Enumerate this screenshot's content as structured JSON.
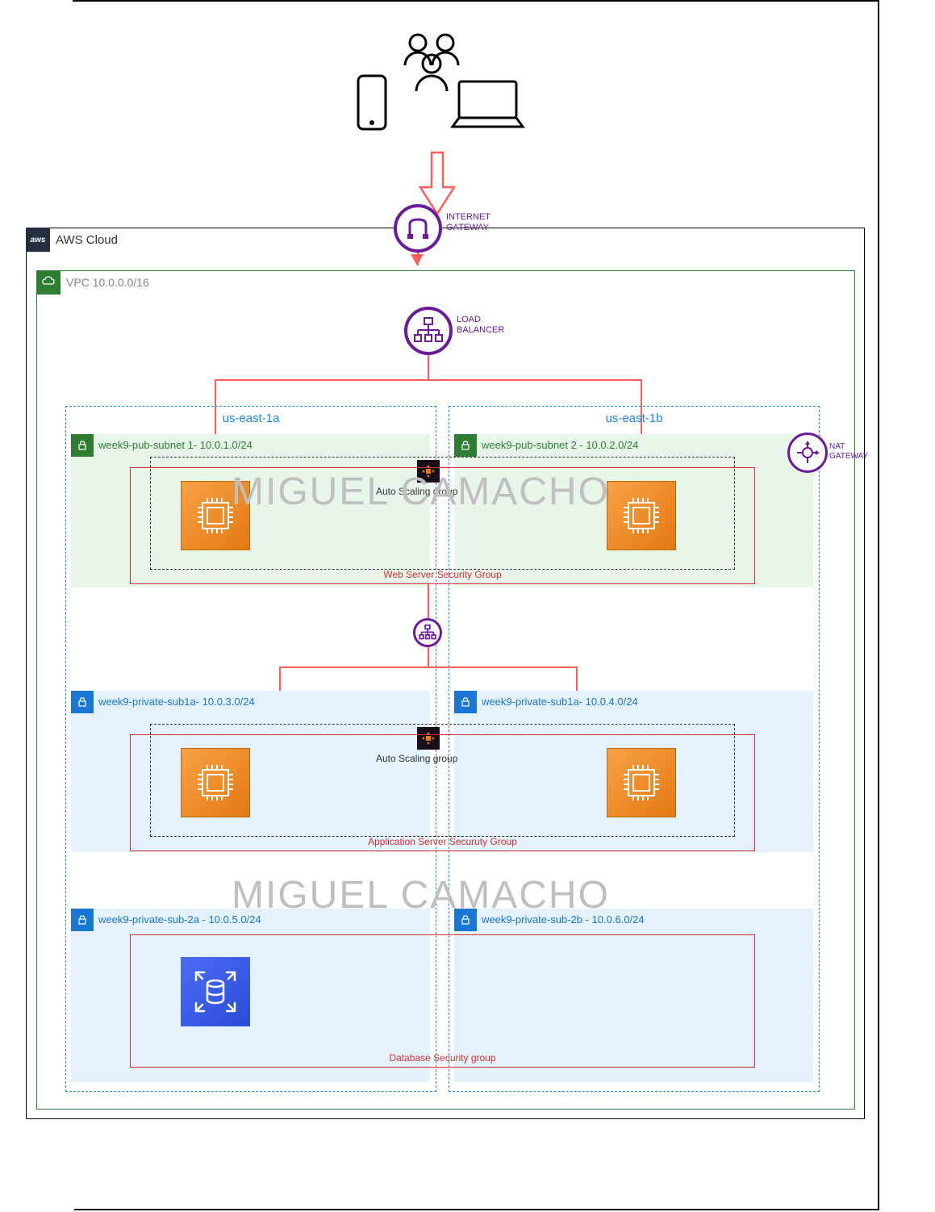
{
  "watermark": "MIGUEL CAMACHO",
  "cloud": {
    "label": "AWS Cloud",
    "badge": "aws"
  },
  "internet_gateway": {
    "label_line1": "INTERNET",
    "label_line2": "GATEWAY"
  },
  "vpc": {
    "label": "VPC 10.0.0.0/16"
  },
  "load_balancer": {
    "label_line1": "LOAD",
    "label_line2": "BALANCER"
  },
  "availability_zones": {
    "a": {
      "title": "us-east-1a"
    },
    "b": {
      "title": "us-east-1b"
    }
  },
  "nat_gateway": {
    "label_line1": "NAT",
    "label_line2": "GATEWAY"
  },
  "tiers": {
    "web": {
      "subnet_a": "week9-pub-subnet 1-  10.0.1.0/24",
      "subnet_b": "week9-pub-subnet 2 - 10.0.2.0/24",
      "asg_label": "Auto Scaling group",
      "sg_label": "Web Server Security Group"
    },
    "app": {
      "subnet_a": "week9-private-sub1a- 10.0.3.0/24",
      "subnet_b": "week9-private-sub1a- 10.0.4.0/24",
      "asg_label": "Auto Scaling group",
      "sg_label": "Application Server Securuty Group"
    },
    "db": {
      "subnet_a": "week9-private-sub-2a - 10.0.5.0/24",
      "subnet_b": "week9-private-sub-2b - 10.0.6.0/24",
      "sg_label": "Database Security group"
    }
  }
}
